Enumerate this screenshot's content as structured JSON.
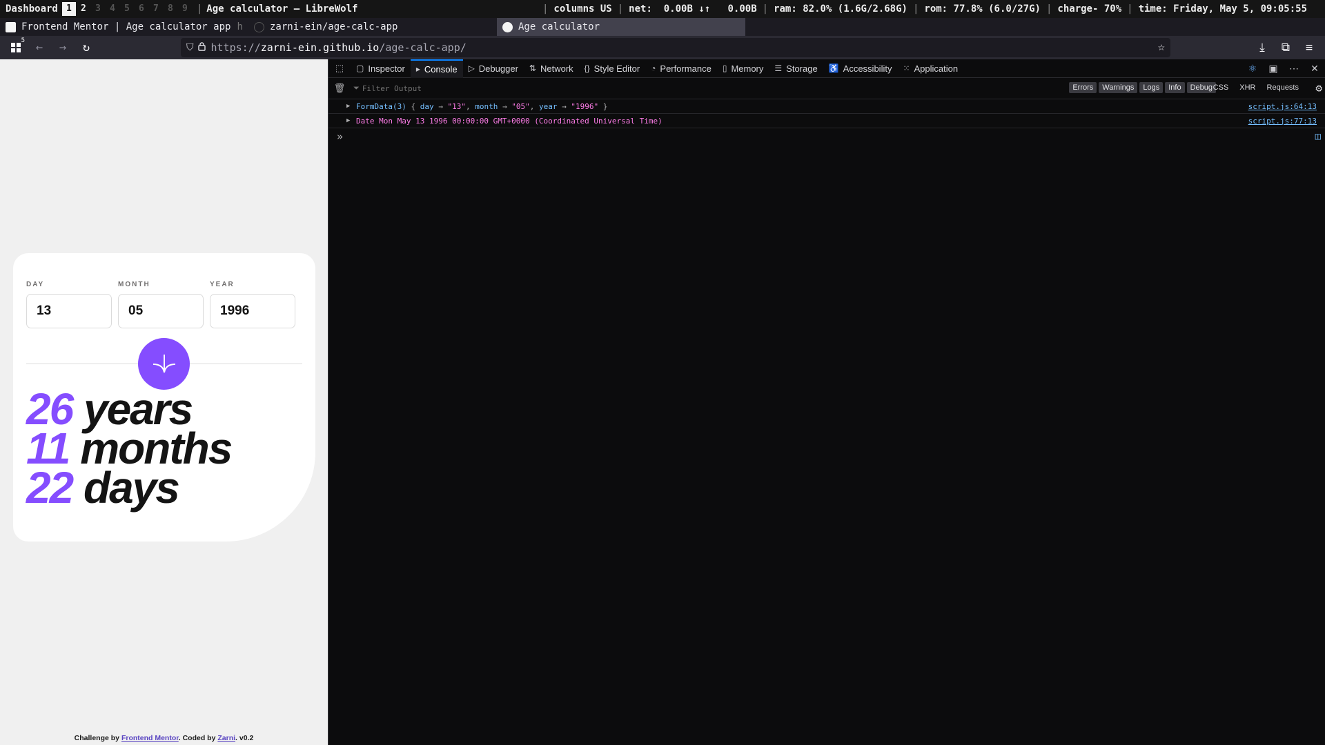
{
  "statusbar": {
    "dashboard": "Dashboard",
    "workspaces": [
      "1",
      "2",
      "3",
      "4",
      "5",
      "6",
      "7",
      "8",
      "9"
    ],
    "active_workspace": "1",
    "window_title": "Age calculator — LibreWolf",
    "columns": "columns US",
    "net_label": "net:",
    "net_down": "0.00B",
    "net_arrows": "↓↑",
    "net_up": "0.00B",
    "ram": "ram: 82.0% (1.6G/2.68G)",
    "rom": "rom: 77.8% (6.0/27G)",
    "charge": "charge- 70%",
    "time": "time: Friday, May 5, 09:05:55"
  },
  "tabs": [
    {
      "title": "Frontend Mentor | Age calculator app",
      "suffix": "h"
    },
    {
      "title": "zarni-ein/age-calc-app",
      "suffix": ""
    },
    {
      "title": "Age calculator",
      "suffix": ""
    }
  ],
  "navbar": {
    "badge": "5",
    "url_prefix": "https://",
    "url_host": "zarni-ein.github.io",
    "url_path": "/age-calc-app/"
  },
  "app": {
    "day_label": "DAY",
    "month_label": "MONTH",
    "year_label": "YEAR",
    "day_value": "13",
    "month_value": "05",
    "year_value": "1996",
    "years_num": "26",
    "years_word": "years",
    "months_num": "11",
    "months_word": "months",
    "days_num": "22",
    "days_word": "days",
    "accent": "#854dff",
    "attribution": {
      "prefix": "Challenge by ",
      "fm": "Frontend Mentor",
      "mid": ". Coded by ",
      "author": "Zarni",
      "version": ". v0.2"
    }
  },
  "devtools": {
    "tabs": [
      "Inspector",
      "Console",
      "Debugger",
      "Network",
      "Style Editor",
      "Performance",
      "Memory",
      "Storage",
      "Accessibility",
      "Application"
    ],
    "selected_tab": "Console",
    "filter_placeholder": "Filter Output",
    "levels": [
      "Errors",
      "Warnings",
      "Logs",
      "Info",
      "Debug"
    ],
    "requests": [
      "CSS",
      "XHR",
      "Requests"
    ],
    "logs": [
      {
        "prefix": "FormData(3)",
        "body_open": " { ",
        "k1": "day",
        "arrow": " → ",
        "v1": "\"13\"",
        "k2": "month",
        "v2": "\"05\"",
        "k3": "year",
        "v3": "\"1996\"",
        "body_close": " }",
        "source": "script.js:64:13"
      },
      {
        "text": "Date Mon May 13 1996 00:00:00 GMT+0000 (Coordinated Universal Time)",
        "source": "script.js:77:13"
      }
    ]
  }
}
